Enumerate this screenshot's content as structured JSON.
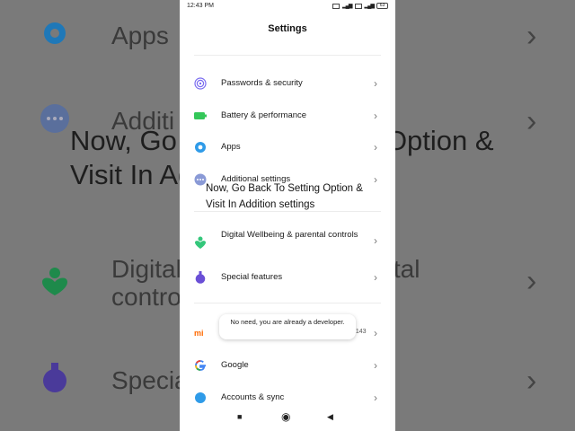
{
  "status_bar": {
    "time": "12:43 PM",
    "sim_labels": [
      "LTE",
      "LTE"
    ],
    "battery": "63"
  },
  "background": {
    "rows": [
      {
        "label": "Apps",
        "icon": "gear-icon",
        "color": "#1f78b8"
      },
      {
        "label": "Additi",
        "icon": "more-icon",
        "color": "#5a6f9c"
      },
      {
        "label": "Digital Wellbeing & parental controls",
        "icon": "heart-person-icon",
        "color": "#1e8a4b"
      },
      {
        "label": "Specia",
        "icon": "flask-icon",
        "color": "#4a3a9a"
      }
    ],
    "caption": "Now, Go Back To Setting Option & Visit In Addition settings"
  },
  "screen": {
    "title": "Settings",
    "items": [
      {
        "label": "Passwords & security",
        "icon": "fingerprint-icon",
        "color": "#7a6cf0"
      },
      {
        "label": "Battery & performance",
        "icon": "battery-icon",
        "color": "#34c759"
      },
      {
        "label": "Apps",
        "icon": "gear-icon",
        "color": "#2f9be8"
      },
      {
        "label": "Additional settings",
        "icon": "more-icon",
        "color": "#8a9ad6"
      },
      {
        "label": "Digital Wellbeing & parental controls",
        "icon": "heart-person-icon",
        "color": "#34c77b"
      },
      {
        "label": "Special features",
        "icon": "flask-icon",
        "color": "#6a4fd6"
      },
      {
        "label": "",
        "icon": "mi-icon",
        "color": "#ff6900"
      },
      {
        "label": "Google",
        "icon": "google-icon",
        "color": "#4285f4"
      },
      {
        "label": "Accounts & sync",
        "icon": "account-icon",
        "color": "#2f9be8"
      }
    ],
    "mi_extra": "5143",
    "caption": "Now, Go Back To Setting Option & Visit In Addition settings",
    "toast": "No need, you are already a developer."
  },
  "navbar": {
    "recents": "■",
    "home": "◉",
    "back": "◀"
  }
}
